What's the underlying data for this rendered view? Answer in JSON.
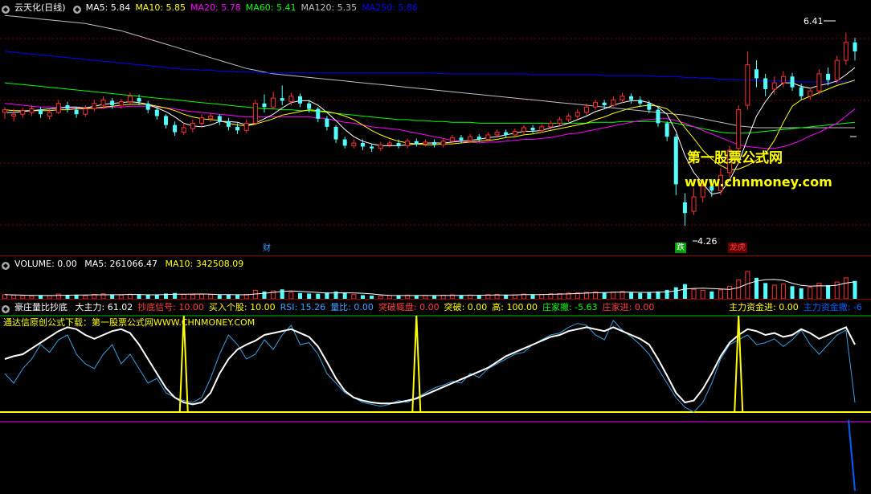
{
  "kline": {
    "title": "云天化(日线)",
    "ma": [
      {
        "label": "MA5:",
        "value": "5.84",
        "color": "#ffffff"
      },
      {
        "label": "MA10:",
        "value": "5.85",
        "color": "#ffff00"
      },
      {
        "label": "MA20:",
        "value": "5.78",
        "color": "#ff00ff"
      },
      {
        "label": "MA60:",
        "value": "5.41",
        "color": "#00ff00"
      },
      {
        "label": "MA120:",
        "value": "5.35",
        "color": "#c0c0c0"
      },
      {
        "label": "MA250:",
        "value": "5.86",
        "color": "#0000ff"
      }
    ],
    "high_label": "6.41",
    "low_label": "4.26",
    "tags": {
      "cai": "财",
      "die": "跌",
      "longhu": "龙虎"
    }
  },
  "volume": {
    "label": "VOLUME:",
    "value": "0.00",
    "ma5_label": "MA5:",
    "ma5_value": "261066.47",
    "ma10_label": "MA10:",
    "ma10_value": "342508.09"
  },
  "indicator": {
    "name": "豪庄量比抄底",
    "items": [
      {
        "label": "大主力:",
        "value": "61.02",
        "color": "#ffffff"
      },
      {
        "label": "抄底信号:",
        "value": "10.00",
        "color": "#ff4040"
      },
      {
        "label": "买入个股:",
        "value": "10.00",
        "color": "#ffff00"
      },
      {
        "label": "RSI:",
        "value": "15.26",
        "color": "#40a0ff"
      },
      {
        "label": "量比:",
        "value": "0.00",
        "color": "#40a0ff"
      },
      {
        "label": "突破辄盘:",
        "value": "0.00",
        "color": "#ff4040"
      },
      {
        "label": "突破:",
        "value": "0.00",
        "color": "#ffff00"
      },
      {
        "label": "高:",
        "value": "100.00",
        "color": "#ffff00"
      },
      {
        "label": "庄家撤:",
        "value": "-5.63",
        "color": "#00ff00"
      },
      {
        "label": "庄家进:",
        "value": "0.00",
        "color": "#ff4040"
      }
    ],
    "right_items": [
      {
        "label": "主力资金进:",
        "value": "0.00",
        "color": "#ffff00"
      },
      {
        "label": "主力资金撤:",
        "value": "-6",
        "color": "#0060ff"
      }
    ],
    "subtitle": "通达信原创公式下载：第一股票公式网WWW.CHNMONEY.COM"
  },
  "watermark": {
    "line1": "第一股票公式网",
    "line2": "www.chnmoney.com"
  },
  "colors": {
    "up": "#ff3232",
    "down": "#54ffff",
    "grid": "#800000",
    "ma5": "#ffffff",
    "ma10": "#ffff00",
    "ma20": "#ff00ff",
    "ma60": "#00ff00",
    "ma120": "#c0c0c0",
    "ma250": "#0000ff"
  },
  "chart_data": {
    "type": "candlestick",
    "price_range": [
      4.26,
      6.41
    ],
    "candles": [
      [
        5.52,
        5.55,
        5.45,
        5.58
      ],
      [
        5.48,
        5.5,
        5.42,
        5.56
      ],
      [
        5.5,
        5.54,
        5.46,
        5.57
      ],
      [
        5.52,
        5.56,
        5.48,
        5.6
      ],
      [
        5.55,
        5.5,
        5.46,
        5.58
      ],
      [
        5.48,
        5.52,
        5.44,
        5.56
      ],
      [
        5.52,
        5.62,
        5.5,
        5.66
      ],
      [
        5.6,
        5.56,
        5.52,
        5.64
      ],
      [
        5.55,
        5.5,
        5.46,
        5.58
      ],
      [
        5.5,
        5.56,
        5.47,
        5.6
      ],
      [
        5.56,
        5.62,
        5.53,
        5.66
      ],
      [
        5.6,
        5.66,
        5.56,
        5.7
      ],
      [
        5.65,
        5.6,
        5.56,
        5.68
      ],
      [
        5.6,
        5.64,
        5.56,
        5.67
      ],
      [
        5.64,
        5.7,
        5.6,
        5.74
      ],
      [
        5.68,
        5.64,
        5.6,
        5.72
      ],
      [
        5.62,
        5.55,
        5.51,
        5.65
      ],
      [
        5.55,
        5.48,
        5.44,
        5.58
      ],
      [
        5.48,
        5.38,
        5.34,
        5.5
      ],
      [
        5.38,
        5.3,
        5.26,
        5.42
      ],
      [
        5.3,
        5.35,
        5.27,
        5.4
      ],
      [
        5.34,
        5.4,
        5.3,
        5.44
      ],
      [
        5.4,
        5.46,
        5.36,
        5.5
      ],
      [
        5.45,
        5.48,
        5.41,
        5.52
      ],
      [
        5.48,
        5.42,
        5.38,
        5.5
      ],
      [
        5.42,
        5.36,
        5.32,
        5.46
      ],
      [
        5.36,
        5.32,
        5.28,
        5.4
      ],
      [
        5.32,
        5.4,
        5.29,
        5.44
      ],
      [
        5.4,
        5.62,
        5.38,
        5.66
      ],
      [
        5.62,
        5.58,
        5.52,
        5.72
      ],
      [
        5.58,
        5.68,
        5.55,
        5.75
      ],
      [
        5.68,
        5.65,
        5.6,
        5.82
      ],
      [
        5.64,
        5.7,
        5.6,
        5.74
      ],
      [
        5.7,
        5.62,
        5.58,
        5.73
      ],
      [
        5.62,
        5.56,
        5.52,
        5.66
      ],
      [
        5.56,
        5.45,
        5.41,
        5.58
      ],
      [
        5.45,
        5.36,
        5.32,
        5.48
      ],
      [
        5.36,
        5.22,
        5.18,
        5.38
      ],
      [
        5.22,
        5.15,
        5.12,
        5.25
      ],
      [
        5.15,
        5.18,
        5.12,
        5.22
      ],
      [
        5.18,
        5.14,
        5.1,
        5.22
      ],
      [
        5.14,
        5.12,
        5.08,
        5.17
      ],
      [
        5.12,
        5.16,
        5.09,
        5.19
      ],
      [
        5.16,
        5.18,
        5.13,
        5.21
      ],
      [
        5.18,
        5.15,
        5.12,
        5.22
      ],
      [
        5.15,
        5.2,
        5.12,
        5.23
      ],
      [
        5.2,
        5.17,
        5.14,
        5.23
      ],
      [
        5.17,
        5.19,
        5.14,
        5.22
      ],
      [
        5.19,
        5.16,
        5.13,
        5.22
      ],
      [
        5.16,
        5.2,
        5.13,
        5.23
      ],
      [
        5.2,
        5.24,
        5.18,
        5.27
      ],
      [
        5.24,
        5.21,
        5.18,
        5.27
      ],
      [
        5.21,
        5.25,
        5.19,
        5.28
      ],
      [
        5.25,
        5.22,
        5.19,
        5.28
      ],
      [
        5.22,
        5.27,
        5.2,
        5.3
      ],
      [
        5.27,
        5.3,
        5.24,
        5.33
      ],
      [
        5.3,
        5.27,
        5.24,
        5.33
      ],
      [
        5.27,
        5.31,
        5.25,
        5.34
      ],
      [
        5.31,
        5.35,
        5.28,
        5.38
      ],
      [
        5.35,
        5.32,
        5.29,
        5.38
      ],
      [
        5.32,
        5.36,
        5.3,
        5.39
      ],
      [
        5.36,
        5.4,
        5.33,
        5.43
      ],
      [
        5.4,
        5.44,
        5.37,
        5.47
      ],
      [
        5.44,
        5.48,
        5.41,
        5.51
      ],
      [
        5.48,
        5.52,
        5.45,
        5.56
      ],
      [
        5.52,
        5.58,
        5.49,
        5.62
      ],
      [
        5.58,
        5.63,
        5.55,
        5.66
      ],
      [
        5.63,
        5.6,
        5.56,
        5.66
      ],
      [
        5.6,
        5.66,
        5.58,
        5.7
      ],
      [
        5.66,
        5.7,
        5.62,
        5.74
      ],
      [
        5.7,
        5.66,
        5.62,
        5.73
      ],
      [
        5.66,
        5.62,
        5.58,
        5.7
      ],
      [
        5.62,
        5.55,
        5.51,
        5.65
      ],
      [
        5.55,
        5.4,
        5.36,
        5.58
      ],
      [
        5.4,
        5.25,
        5.2,
        5.42
      ],
      [
        5.25,
        4.72,
        4.6,
        5.28
      ],
      [
        4.52,
        4.4,
        4.26,
        4.62
      ],
      [
        4.42,
        4.58,
        4.38,
        4.68
      ],
      [
        4.58,
        4.7,
        4.52,
        4.76
      ],
      [
        4.7,
        4.65,
        4.58,
        4.78
      ],
      [
        4.65,
        4.82,
        4.6,
        4.9
      ],
      [
        4.85,
        5.1,
        4.8,
        5.15
      ],
      [
        5.12,
        5.55,
        5.05,
        5.6
      ],
      [
        5.6,
        6.05,
        5.55,
        6.2
      ],
      [
        6.0,
        5.9,
        5.8,
        6.1
      ],
      [
        5.9,
        5.78,
        5.7,
        5.95
      ],
      [
        5.78,
        5.85,
        5.72,
        5.92
      ],
      [
        5.85,
        5.92,
        5.8,
        5.98
      ],
      [
        5.92,
        5.8,
        5.76,
        5.96
      ],
      [
        5.8,
        5.7,
        5.66,
        5.84
      ],
      [
        5.7,
        5.76,
        5.66,
        5.8
      ],
      [
        5.76,
        5.95,
        5.72,
        6.0
      ],
      [
        5.95,
        5.88,
        5.82,
        6.02
      ],
      [
        5.88,
        6.1,
        5.84,
        6.15
      ],
      [
        6.1,
        6.3,
        6.05,
        6.41
      ],
      [
        6.3,
        6.2,
        6.1,
        6.35
      ]
    ],
    "ma5": [
      5.52,
      5.52,
      5.53,
      5.54,
      5.55,
      5.56,
      5.57,
      5.58,
      5.58,
      5.57,
      5.59,
      5.61,
      5.62,
      5.63,
      5.64,
      5.63,
      5.61,
      5.57,
      5.53,
      5.47,
      5.4,
      5.37,
      5.36,
      5.38,
      5.42,
      5.42,
      5.41,
      5.38,
      5.4,
      5.45,
      5.5,
      5.57,
      5.63,
      5.65,
      5.65,
      5.6,
      5.52,
      5.43,
      5.33,
      5.25,
      5.2,
      5.17,
      5.15,
      5.15,
      5.15,
      5.16,
      5.17,
      5.18,
      5.18,
      5.18,
      5.19,
      5.2,
      5.21,
      5.22,
      5.24,
      5.25,
      5.27,
      5.29,
      5.31,
      5.31,
      5.32,
      5.35,
      5.37,
      5.4,
      5.44,
      5.48,
      5.53,
      5.56,
      5.6,
      5.63,
      5.65,
      5.65,
      5.63,
      5.58,
      5.5,
      5.31,
      5.04,
      4.85,
      4.73,
      4.61,
      4.63,
      4.77,
      4.96,
      5.23,
      5.48,
      5.64,
      5.77,
      5.85,
      5.85,
      5.81,
      5.79,
      5.82,
      5.84,
      5.87,
      5.94,
      6.02
    ],
    "ma10": [
      5.55,
      5.54,
      5.54,
      5.54,
      5.54,
      5.54,
      5.55,
      5.55,
      5.56,
      5.56,
      5.57,
      5.58,
      5.59,
      5.6,
      5.61,
      5.61,
      5.61,
      5.59,
      5.57,
      5.54,
      5.5,
      5.47,
      5.45,
      5.44,
      5.43,
      5.4,
      5.38,
      5.37,
      5.39,
      5.42,
      5.45,
      5.49,
      5.51,
      5.53,
      5.55,
      5.54,
      5.53,
      5.51,
      5.48,
      5.44,
      5.38,
      5.32,
      5.27,
      5.23,
      5.2,
      5.18,
      5.17,
      5.16,
      5.16,
      5.17,
      5.17,
      5.18,
      5.19,
      5.2,
      5.21,
      5.22,
      5.24,
      5.25,
      5.27,
      5.28,
      5.3,
      5.32,
      5.34,
      5.36,
      5.38,
      5.4,
      5.44,
      5.47,
      5.51,
      5.54,
      5.57,
      5.59,
      5.6,
      5.59,
      5.56,
      5.48,
      5.35,
      5.23,
      5.1,
      5.0,
      4.93,
      4.88,
      4.89,
      4.93,
      4.99,
      5.06,
      5.21,
      5.41,
      5.59,
      5.66,
      5.7,
      5.74,
      5.78,
      5.82,
      5.85,
      5.88
    ],
    "ma20": [
      5.62,
      5.61,
      5.6,
      5.59,
      5.58,
      5.58,
      5.57,
      5.57,
      5.57,
      5.57,
      5.57,
      5.57,
      5.58,
      5.58,
      5.59,
      5.59,
      5.59,
      5.58,
      5.57,
      5.56,
      5.54,
      5.53,
      5.52,
      5.51,
      5.5,
      5.49,
      5.48,
      5.47,
      5.47,
      5.47,
      5.47,
      5.47,
      5.47,
      5.47,
      5.47,
      5.46,
      5.45,
      5.43,
      5.41,
      5.4,
      5.38,
      5.36,
      5.35,
      5.34,
      5.33,
      5.31,
      5.29,
      5.27,
      5.25,
      5.23,
      5.21,
      5.2,
      5.19,
      5.18,
      5.19,
      5.19,
      5.2,
      5.21,
      5.22,
      5.22,
      5.23,
      5.24,
      5.26,
      5.28,
      5.29,
      5.31,
      5.33,
      5.35,
      5.37,
      5.39,
      5.41,
      5.43,
      5.44,
      5.45,
      5.45,
      5.43,
      5.4,
      5.36,
      5.32,
      5.28,
      5.24,
      5.2,
      5.16,
      5.14,
      5.13,
      5.12,
      5.12,
      5.14,
      5.17,
      5.21,
      5.26,
      5.3,
      5.35,
      5.4,
      5.48,
      5.56
    ],
    "ma60": [
      5.85,
      5.84,
      5.83,
      5.82,
      5.81,
      5.8,
      5.79,
      5.78,
      5.77,
      5.76,
      5.75,
      5.74,
      5.73,
      5.72,
      5.71,
      5.7,
      5.69,
      5.68,
      5.67,
      5.66,
      5.65,
      5.64,
      5.63,
      5.62,
      5.61,
      5.6,
      5.59,
      5.58,
      5.57,
      5.56,
      5.56,
      5.55,
      5.55,
      5.54,
      5.54,
      5.53,
      5.52,
      5.51,
      5.5,
      5.49,
      5.48,
      5.47,
      5.46,
      5.45,
      5.44,
      5.44,
      5.43,
      5.43,
      5.42,
      5.42,
      5.41,
      5.41,
      5.41,
      5.4,
      5.4,
      5.4,
      5.4,
      5.4,
      5.4,
      5.4,
      5.4,
      5.4,
      5.4,
      5.4,
      5.4,
      5.4,
      5.41,
      5.41,
      5.41,
      5.42,
      5.42,
      5.42,
      5.42,
      5.42,
      5.41,
      5.4,
      5.38,
      5.36,
      5.34,
      5.32,
      5.3,
      5.29,
      5.29,
      5.29,
      5.3,
      5.31,
      5.32,
      5.33,
      5.34,
      5.35,
      5.36,
      5.37,
      5.38,
      5.39,
      5.4,
      5.41
    ],
    "ma120": [
      6.6,
      6.59,
      6.58,
      6.57,
      6.56,
      6.55,
      6.54,
      6.53,
      6.52,
      6.51,
      6.49,
      6.47,
      6.45,
      6.43,
      6.4,
      6.37,
      6.34,
      6.31,
      6.28,
      6.25,
      6.22,
      6.19,
      6.16,
      6.13,
      6.1,
      6.07,
      6.04,
      6.01,
      5.99,
      5.97,
      5.95,
      5.94,
      5.93,
      5.92,
      5.91,
      5.9,
      5.89,
      5.88,
      5.87,
      5.86,
      5.85,
      5.84,
      5.83,
      5.82,
      5.81,
      5.8,
      5.79,
      5.78,
      5.77,
      5.76,
      5.75,
      5.74,
      5.73,
      5.72,
      5.71,
      5.7,
      5.69,
      5.68,
      5.67,
      5.66,
      5.65,
      5.64,
      5.63,
      5.62,
      5.61,
      5.6,
      5.59,
      5.58,
      5.57,
      5.56,
      5.55,
      5.54,
      5.53,
      5.52,
      5.51,
      5.5,
      5.49,
      5.47,
      5.45,
      5.43,
      5.41,
      5.39,
      5.37,
      5.36,
      5.35,
      5.35,
      5.35,
      5.35,
      5.35,
      5.35,
      5.35,
      5.35,
      5.35,
      5.35,
      5.35,
      5.35
    ],
    "ma250": [
      6.2,
      6.19,
      6.18,
      6.17,
      6.16,
      6.15,
      6.14,
      6.13,
      6.12,
      6.11,
      6.1,
      6.09,
      6.08,
      6.07,
      6.06,
      6.05,
      6.04,
      6.03,
      6.02,
      6.01,
      6.0,
      6.0,
      5.99,
      5.99,
      5.98,
      5.98,
      5.97,
      5.97,
      5.97,
      5.96,
      5.96,
      5.96,
      5.96,
      5.96,
      5.96,
      5.96,
      5.96,
      5.96,
      5.96,
      5.96,
      5.96,
      5.96,
      5.96,
      5.96,
      5.96,
      5.96,
      5.96,
      5.96,
      5.96,
      5.95,
      5.95,
      5.95,
      5.95,
      5.95,
      5.95,
      5.95,
      5.95,
      5.95,
      5.95,
      5.94,
      5.94,
      5.94,
      5.94,
      5.94,
      5.94,
      5.94,
      5.94,
      5.93,
      5.93,
      5.93,
      5.93,
      5.93,
      5.93,
      5.92,
      5.92,
      5.92,
      5.91,
      5.91,
      5.9,
      5.9,
      5.89,
      5.89,
      5.88,
      5.88,
      5.88,
      5.87,
      5.87,
      5.87,
      5.87,
      5.86,
      5.86,
      5.86,
      5.86,
      5.86,
      5.86,
      5.86
    ],
    "volume": [
      40,
      35,
      30,
      28,
      32,
      30,
      45,
      38,
      35,
      30,
      42,
      48,
      40,
      36,
      44,
      38,
      35,
      40,
      50,
      55,
      42,
      38,
      45,
      40,
      36,
      38,
      35,
      42,
      80,
      70,
      75,
      90,
      60,
      55,
      50,
      48,
      60,
      70,
      58,
      40,
      35,
      30,
      28,
      32,
      30,
      35,
      32,
      30,
      28,
      34,
      38,
      32,
      36,
      30,
      40,
      42,
      35,
      38,
      45,
      40,
      42,
      48,
      50,
      55,
      58,
      62,
      66,
      58,
      64,
      70,
      60,
      55,
      58,
      70,
      85,
      110,
      140,
      90,
      80,
      70,
      85,
      120,
      180,
      260,
      200,
      150,
      130,
      140,
      120,
      100,
      110,
      150,
      130,
      160,
      200,
      170
    ],
    "indicator": {
      "white": [
        55,
        58,
        60,
        66,
        72,
        78,
        84,
        88,
        86,
        80,
        76,
        80,
        84,
        86,
        82,
        70,
        55,
        40,
        25,
        15,
        10,
        8,
        10,
        20,
        40,
        55,
        65,
        70,
        74,
        80,
        82,
        84,
        86,
        82,
        78,
        68,
        52,
        35,
        22,
        15,
        12,
        10,
        9,
        9,
        10,
        12,
        14,
        18,
        22,
        26,
        30,
        34,
        38,
        42,
        46,
        52,
        58,
        62,
        66,
        70,
        74,
        78,
        80,
        84,
        86,
        88,
        86,
        84,
        88,
        84,
        80,
        76,
        70,
        55,
        38,
        20,
        10,
        12,
        24,
        40,
        58,
        72,
        80,
        86,
        84,
        80,
        82,
        78,
        80,
        86,
        82,
        76,
        80,
        84,
        88,
        70
      ],
      "cyan": [
        40,
        30,
        45,
        55,
        70,
        62,
        75,
        80,
        60,
        50,
        45,
        60,
        70,
        50,
        60,
        45,
        30,
        35,
        20,
        15,
        12,
        10,
        15,
        35,
        60,
        80,
        70,
        55,
        60,
        75,
        65,
        80,
        90,
        70,
        72,
        60,
        40,
        30,
        20,
        15,
        10,
        8,
        6,
        8,
        12,
        10,
        15,
        20,
        25,
        28,
        32,
        30,
        40,
        36,
        45,
        50,
        55,
        60,
        62,
        70,
        75,
        80,
        82,
        88,
        92,
        90,
        80,
        75,
        95,
        85,
        78,
        70,
        60,
        45,
        30,
        15,
        5,
        0,
        10,
        30,
        55,
        70,
        75,
        80,
        70,
        72,
        76,
        68,
        75,
        85,
        70,
        60,
        70,
        80,
        85,
        10
      ],
      "yellow_spikes": [
        20,
        46,
        82
      ]
    }
  }
}
